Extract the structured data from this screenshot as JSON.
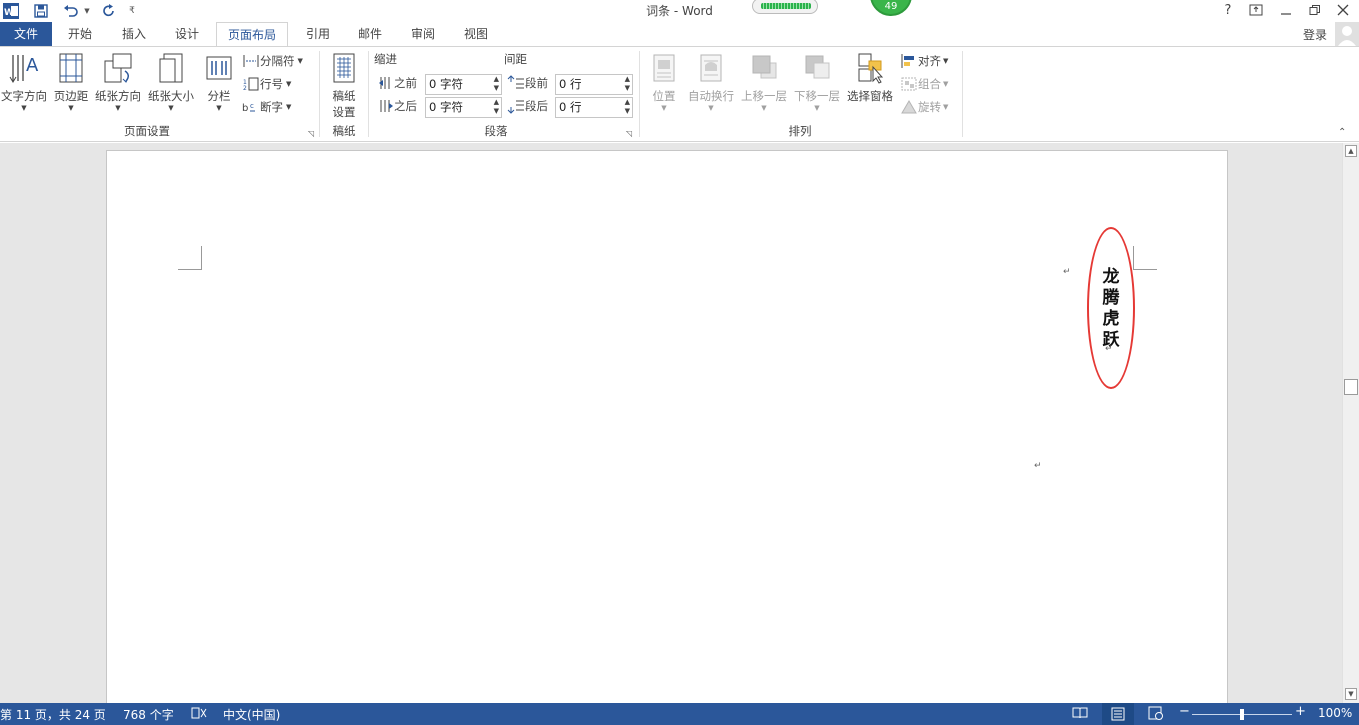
{
  "window": {
    "title": "词条 - Word",
    "badge": "49",
    "help": "?",
    "login": "登录"
  },
  "tabs": [
    {
      "label": "文件"
    },
    {
      "label": "开始"
    },
    {
      "label": "插入"
    },
    {
      "label": "设计"
    },
    {
      "label": "页面布局"
    },
    {
      "label": "引用"
    },
    {
      "label": "邮件"
    },
    {
      "label": "审阅"
    },
    {
      "label": "视图"
    }
  ],
  "ribbon": {
    "page_setup": {
      "text_direction": "文字方向",
      "margins": "页边距",
      "orientation": "纸张方向",
      "size": "纸张大小",
      "columns": "分栏",
      "breaks": "分隔符",
      "line_numbers": "行号",
      "hyphenation": "断字",
      "label": "页面设置"
    },
    "manuscript": {
      "setup_line1": "稿纸",
      "setup_line2": "设置",
      "label": "稿纸"
    },
    "paragraph": {
      "indent_header": "缩进",
      "spacing_header": "间距",
      "before_label": "之前",
      "after_label": "之后",
      "indent_before_value": "0 字符",
      "indent_after_value": "0 字符",
      "space_before_label": "段前",
      "space_after_label": "段后",
      "space_before_value": "0 行",
      "space_after_value": "0 行",
      "label": "段落"
    },
    "arrange": {
      "position": "位置",
      "wrap_text": "自动换行",
      "bring_forward": "上移一层",
      "send_backward": "下移一层",
      "selection_pane": "选择窗格",
      "align": "对齐",
      "group": "组合",
      "rotate": "旋转",
      "label": "排列"
    }
  },
  "document": {
    "vertical_text": "龙腾虎跃"
  },
  "statusbar": {
    "page": "第 11 页，共 24 页",
    "words": "768 个字",
    "language": "中文(中国)",
    "zoom_minus": "−",
    "zoom_plus": "+",
    "zoom": "100%",
    "zoom_level_percent": 100
  }
}
